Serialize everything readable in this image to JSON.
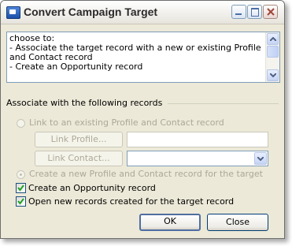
{
  "window": {
    "title": "Convert Campaign Target",
    "title_icon": "app-window-icon",
    "controls": [
      "minimize-icon",
      "maximize-icon",
      "close-icon"
    ]
  },
  "description": {
    "text": "choose to:\n- Associate the target record with a new or existing Profile\nand Contact record\n- Create an Opportunity record"
  },
  "associate_group": {
    "label": "Associate with the following records",
    "link_existing_label": "Link to an existing Profile and Contact record",
    "link_existing_selected": false,
    "link_profile_button": "Link Profile...",
    "profile_value": "",
    "link_contact_button": "Link Contact...",
    "contact_value": "",
    "create_new_label": "Create a new Profile and Contact record for the target",
    "create_new_selected": true
  },
  "options": {
    "create_opportunity_label": "Create an Opportunity record",
    "create_opportunity_checked": true,
    "open_new_records_label": "Open new records created for the target record",
    "open_new_records_checked": true
  },
  "buttons": {
    "ok": "OK",
    "close": "Close"
  }
}
